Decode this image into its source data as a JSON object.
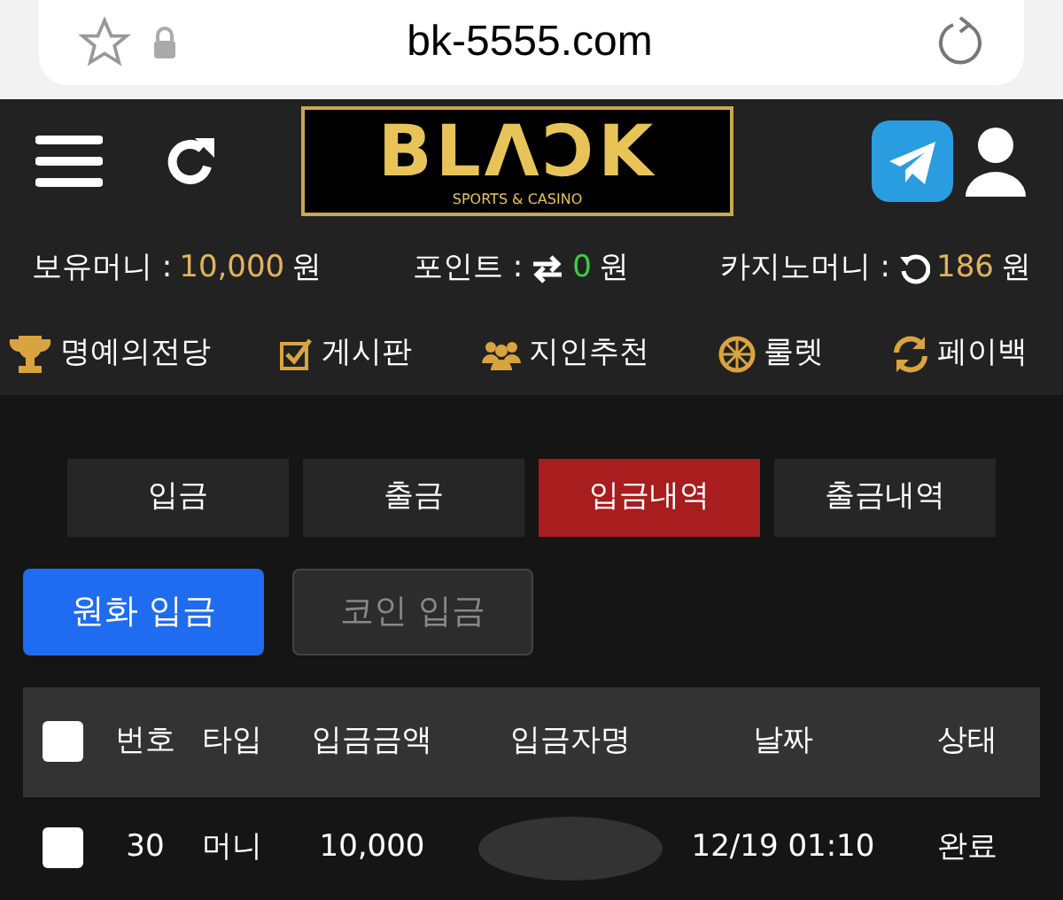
{
  "browser": {
    "url": "bk-5555.com"
  },
  "logo": {
    "title": "BLΛƆK",
    "subtitle": "SPORTS & CASINO"
  },
  "balances": [
    {
      "label": "보유머니 :",
      "value": "10,000",
      "unit": "원",
      "color": "#e0b35a"
    },
    {
      "label": "포인트 :",
      "value": "0",
      "unit": "원",
      "color": "#3ec94a"
    },
    {
      "label": "카지노머니 :",
      "value": "186",
      "unit": "원",
      "color": "#e0b35a"
    }
  ],
  "menu": [
    {
      "label": "명예의전당"
    },
    {
      "label": "게시판"
    },
    {
      "label": "지인추천"
    },
    {
      "label": "룰렛"
    },
    {
      "label": "페이백"
    }
  ],
  "tabs": [
    {
      "label": "입금",
      "selected": false
    },
    {
      "label": "출금",
      "selected": false
    },
    {
      "label": "입금내역",
      "selected": true
    },
    {
      "label": "출금내역",
      "selected": false
    }
  ],
  "subtabs": [
    {
      "label": "원화 입금",
      "selected": true
    },
    {
      "label": "코인 입금",
      "selected": false
    }
  ],
  "table": {
    "header_checked": false,
    "columns": [
      "번호",
      "타입",
      "입금금액",
      "입금자명",
      "날짜",
      "상태"
    ],
    "rows": [
      {
        "checked": false,
        "cells": [
          "30",
          "머니",
          "10,000",
          null,
          "12/19 01:10",
          "완료"
        ]
      }
    ]
  }
}
